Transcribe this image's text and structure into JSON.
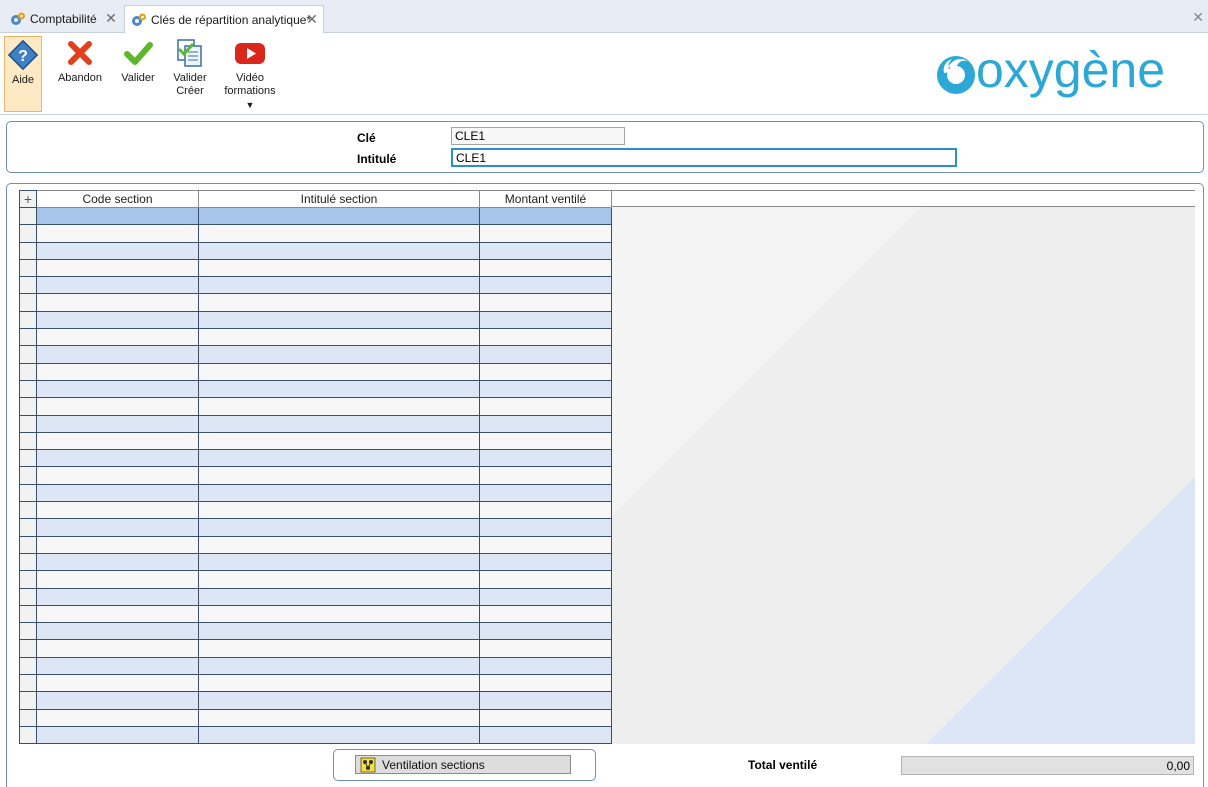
{
  "tabs": [
    {
      "label": "Comptabilité",
      "active": false
    },
    {
      "label": "Clés de répartition analytique*",
      "active": true
    }
  ],
  "toolbar": {
    "aide": "Aide",
    "abandon": "Abandon",
    "valider": "Valider",
    "valider_creer_1": "Valider",
    "valider_creer_2": "Créer",
    "video_1": "Vidéo",
    "video_2": "formations"
  },
  "logo": {
    "text": "oxygène",
    "color": "#2ba8d6"
  },
  "form": {
    "cle_label": "Clé",
    "cle_value": "CLE1",
    "intitule_label": "Intitulé",
    "intitule_value": "CLE1"
  },
  "grid": {
    "add_symbol": "+",
    "columns": [
      "Code section",
      "Intitulé section",
      "Montant ventilé"
    ],
    "row_count": 31,
    "selected_row": 0
  },
  "footer": {
    "ventilation_button": "Ventilation sections",
    "total_label": "Total ventilé",
    "total_value": "0,00"
  },
  "colors": {
    "accent": "#2c8fc9",
    "row_alt": "#dce6f5",
    "row_selected": "#a7c5ea",
    "panel_border": "#6f8fb8"
  }
}
